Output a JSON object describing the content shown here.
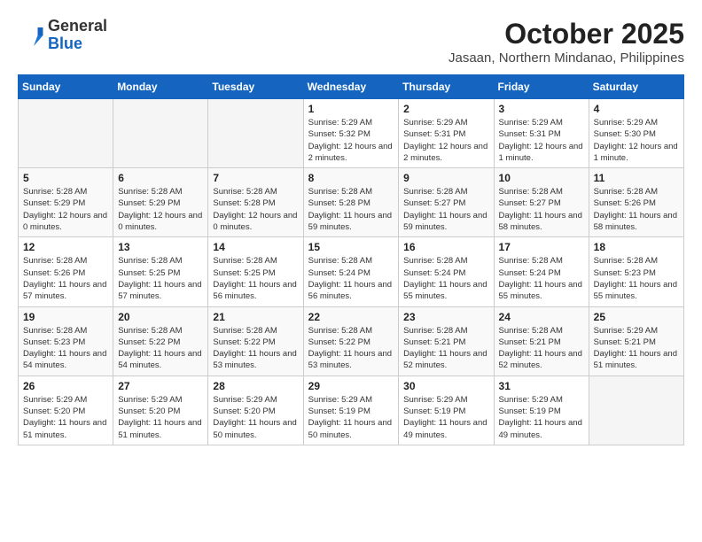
{
  "header": {
    "logo_general": "General",
    "logo_blue": "Blue",
    "month_year": "October 2025",
    "location": "Jasaan, Northern Mindanao, Philippines"
  },
  "weekdays": [
    "Sunday",
    "Monday",
    "Tuesday",
    "Wednesday",
    "Thursday",
    "Friday",
    "Saturday"
  ],
  "weeks": [
    [
      {
        "day": "",
        "sunrise": "",
        "sunset": "",
        "daylight": ""
      },
      {
        "day": "",
        "sunrise": "",
        "sunset": "",
        "daylight": ""
      },
      {
        "day": "",
        "sunrise": "",
        "sunset": "",
        "daylight": ""
      },
      {
        "day": "1",
        "sunrise": "Sunrise: 5:29 AM",
        "sunset": "Sunset: 5:32 PM",
        "daylight": "Daylight: 12 hours and 2 minutes."
      },
      {
        "day": "2",
        "sunrise": "Sunrise: 5:29 AM",
        "sunset": "Sunset: 5:31 PM",
        "daylight": "Daylight: 12 hours and 2 minutes."
      },
      {
        "day": "3",
        "sunrise": "Sunrise: 5:29 AM",
        "sunset": "Sunset: 5:31 PM",
        "daylight": "Daylight: 12 hours and 1 minute."
      },
      {
        "day": "4",
        "sunrise": "Sunrise: 5:29 AM",
        "sunset": "Sunset: 5:30 PM",
        "daylight": "Daylight: 12 hours and 1 minute."
      }
    ],
    [
      {
        "day": "5",
        "sunrise": "Sunrise: 5:28 AM",
        "sunset": "Sunset: 5:29 PM",
        "daylight": "Daylight: 12 hours and 0 minutes."
      },
      {
        "day": "6",
        "sunrise": "Sunrise: 5:28 AM",
        "sunset": "Sunset: 5:29 PM",
        "daylight": "Daylight: 12 hours and 0 minutes."
      },
      {
        "day": "7",
        "sunrise": "Sunrise: 5:28 AM",
        "sunset": "Sunset: 5:28 PM",
        "daylight": "Daylight: 12 hours and 0 minutes."
      },
      {
        "day": "8",
        "sunrise": "Sunrise: 5:28 AM",
        "sunset": "Sunset: 5:28 PM",
        "daylight": "Daylight: 11 hours and 59 minutes."
      },
      {
        "day": "9",
        "sunrise": "Sunrise: 5:28 AM",
        "sunset": "Sunset: 5:27 PM",
        "daylight": "Daylight: 11 hours and 59 minutes."
      },
      {
        "day": "10",
        "sunrise": "Sunrise: 5:28 AM",
        "sunset": "Sunset: 5:27 PM",
        "daylight": "Daylight: 11 hours and 58 minutes."
      },
      {
        "day": "11",
        "sunrise": "Sunrise: 5:28 AM",
        "sunset": "Sunset: 5:26 PM",
        "daylight": "Daylight: 11 hours and 58 minutes."
      }
    ],
    [
      {
        "day": "12",
        "sunrise": "Sunrise: 5:28 AM",
        "sunset": "Sunset: 5:26 PM",
        "daylight": "Daylight: 11 hours and 57 minutes."
      },
      {
        "day": "13",
        "sunrise": "Sunrise: 5:28 AM",
        "sunset": "Sunset: 5:25 PM",
        "daylight": "Daylight: 11 hours and 57 minutes."
      },
      {
        "day": "14",
        "sunrise": "Sunrise: 5:28 AM",
        "sunset": "Sunset: 5:25 PM",
        "daylight": "Daylight: 11 hours and 56 minutes."
      },
      {
        "day": "15",
        "sunrise": "Sunrise: 5:28 AM",
        "sunset": "Sunset: 5:24 PM",
        "daylight": "Daylight: 11 hours and 56 minutes."
      },
      {
        "day": "16",
        "sunrise": "Sunrise: 5:28 AM",
        "sunset": "Sunset: 5:24 PM",
        "daylight": "Daylight: 11 hours and 55 minutes."
      },
      {
        "day": "17",
        "sunrise": "Sunrise: 5:28 AM",
        "sunset": "Sunset: 5:24 PM",
        "daylight": "Daylight: 11 hours and 55 minutes."
      },
      {
        "day": "18",
        "sunrise": "Sunrise: 5:28 AM",
        "sunset": "Sunset: 5:23 PM",
        "daylight": "Daylight: 11 hours and 55 minutes."
      }
    ],
    [
      {
        "day": "19",
        "sunrise": "Sunrise: 5:28 AM",
        "sunset": "Sunset: 5:23 PM",
        "daylight": "Daylight: 11 hours and 54 minutes."
      },
      {
        "day": "20",
        "sunrise": "Sunrise: 5:28 AM",
        "sunset": "Sunset: 5:22 PM",
        "daylight": "Daylight: 11 hours and 54 minutes."
      },
      {
        "day": "21",
        "sunrise": "Sunrise: 5:28 AM",
        "sunset": "Sunset: 5:22 PM",
        "daylight": "Daylight: 11 hours and 53 minutes."
      },
      {
        "day": "22",
        "sunrise": "Sunrise: 5:28 AM",
        "sunset": "Sunset: 5:22 PM",
        "daylight": "Daylight: 11 hours and 53 minutes."
      },
      {
        "day": "23",
        "sunrise": "Sunrise: 5:28 AM",
        "sunset": "Sunset: 5:21 PM",
        "daylight": "Daylight: 11 hours and 52 minutes."
      },
      {
        "day": "24",
        "sunrise": "Sunrise: 5:28 AM",
        "sunset": "Sunset: 5:21 PM",
        "daylight": "Daylight: 11 hours and 52 minutes."
      },
      {
        "day": "25",
        "sunrise": "Sunrise: 5:29 AM",
        "sunset": "Sunset: 5:21 PM",
        "daylight": "Daylight: 11 hours and 51 minutes."
      }
    ],
    [
      {
        "day": "26",
        "sunrise": "Sunrise: 5:29 AM",
        "sunset": "Sunset: 5:20 PM",
        "daylight": "Daylight: 11 hours and 51 minutes."
      },
      {
        "day": "27",
        "sunrise": "Sunrise: 5:29 AM",
        "sunset": "Sunset: 5:20 PM",
        "daylight": "Daylight: 11 hours and 51 minutes."
      },
      {
        "day": "28",
        "sunrise": "Sunrise: 5:29 AM",
        "sunset": "Sunset: 5:20 PM",
        "daylight": "Daylight: 11 hours and 50 minutes."
      },
      {
        "day": "29",
        "sunrise": "Sunrise: 5:29 AM",
        "sunset": "Sunset: 5:19 PM",
        "daylight": "Daylight: 11 hours and 50 minutes."
      },
      {
        "day": "30",
        "sunrise": "Sunrise: 5:29 AM",
        "sunset": "Sunset: 5:19 PM",
        "daylight": "Daylight: 11 hours and 49 minutes."
      },
      {
        "day": "31",
        "sunrise": "Sunrise: 5:29 AM",
        "sunset": "Sunset: 5:19 PM",
        "daylight": "Daylight: 11 hours and 49 minutes."
      },
      {
        "day": "",
        "sunrise": "",
        "sunset": "",
        "daylight": ""
      }
    ]
  ]
}
